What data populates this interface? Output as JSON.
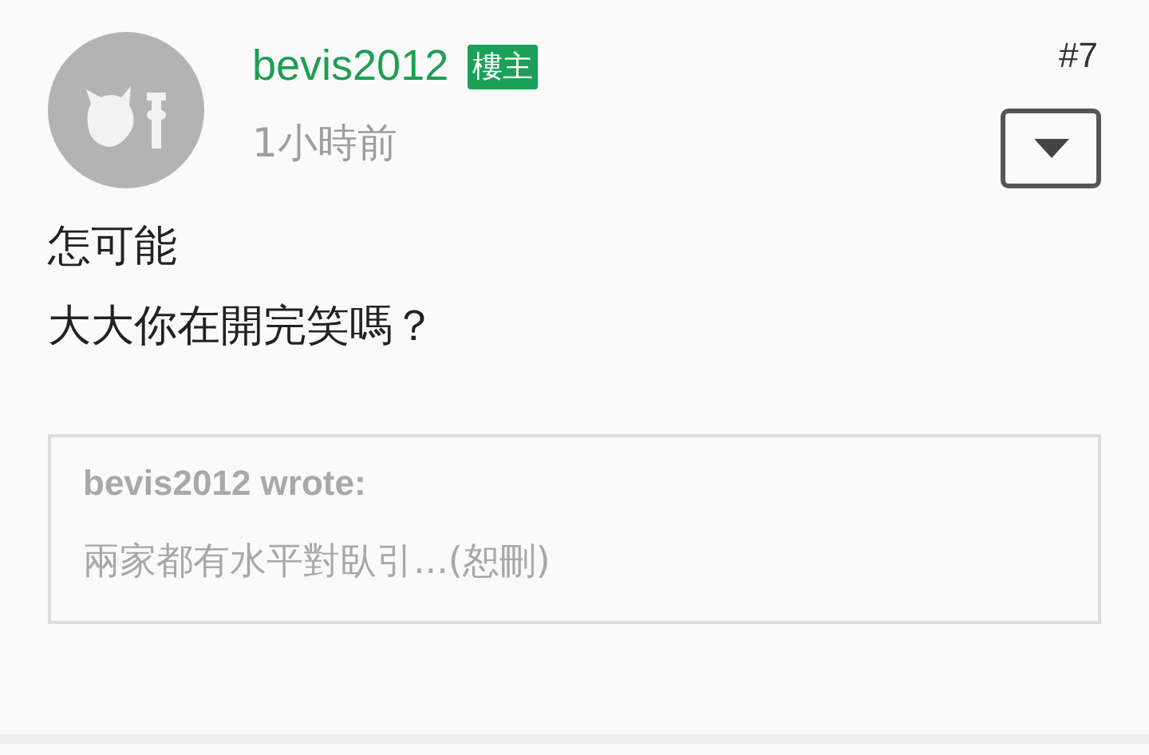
{
  "post": {
    "author": "bevis2012",
    "badge": "樓主",
    "time": "1小時前",
    "floor": "#7",
    "body": [
      "怎可能",
      "大大你在開完笑嗎？"
    ],
    "quote": {
      "header": "bevis2012 wrote:",
      "text": "兩家都有水平對臥引...(恕刪)"
    }
  }
}
